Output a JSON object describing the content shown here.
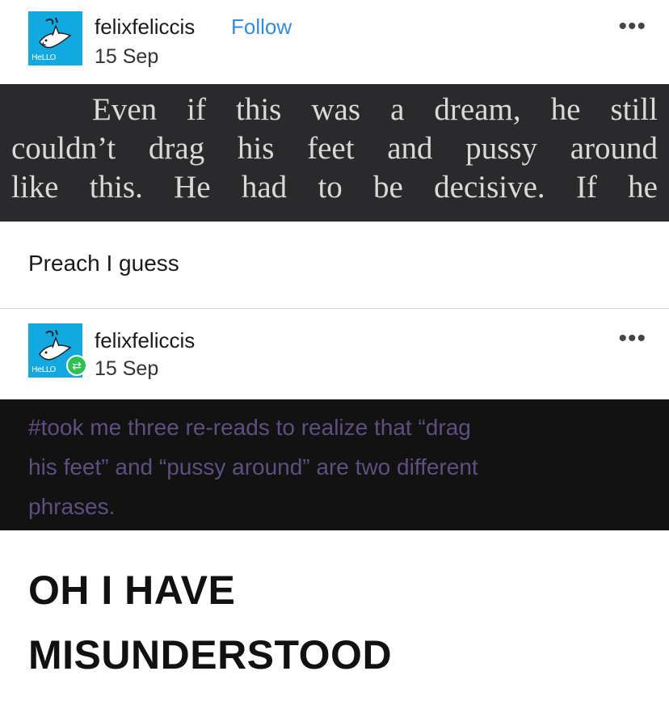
{
  "post1": {
    "username": "felixfeliccis",
    "follow_label": "Follow",
    "date": "15 Sep",
    "avatar_text": "HeLLO",
    "more_label": "•••"
  },
  "excerpt": {
    "line1": "Even if this was a dream, he still",
    "line2": "couldn’t drag his feet and pussy around",
    "line3": "like this. He had to be decisive. If he"
  },
  "comment": "Preach I guess",
  "post2": {
    "username": "felixfeliccis",
    "date": "15 Sep",
    "avatar_text": "HeLLO",
    "more_label": "•••"
  },
  "tags": {
    "line1": "#took me three re-reads to realize that “drag",
    "line2": "his feet” and “pussy around” are two different",
    "line3": "phrases."
  },
  "reaction": {
    "line1": "OH I HAVE",
    "line2": "MISUNDERSTOOD"
  },
  "colors": {
    "avatar_bg": "#12a8e0",
    "follow": "#2f8ce0",
    "excerpt_bg": "#2a2a2c",
    "tags_bg": "#121212",
    "tags_text": "#5e4f80",
    "reblog_badge": "#2cc24e"
  }
}
